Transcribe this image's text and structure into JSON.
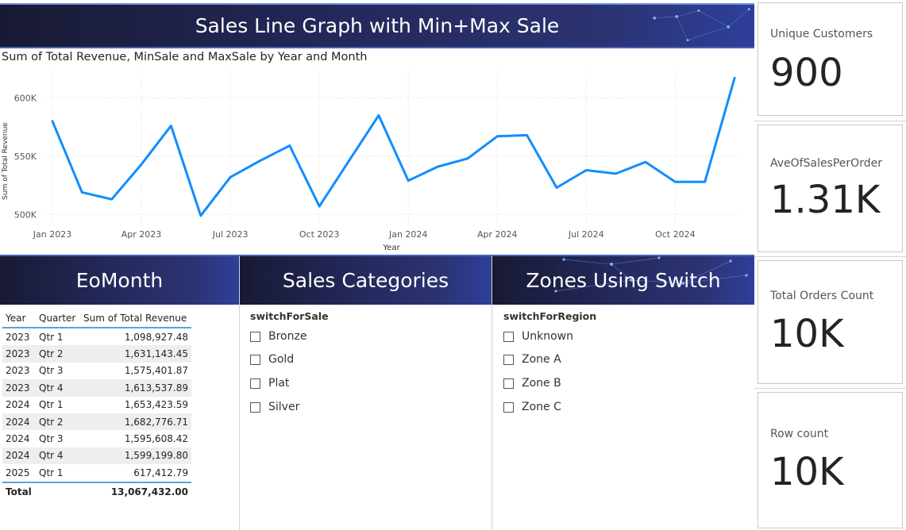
{
  "header": {
    "title": "Sales Line Graph with Min+Max Sale"
  },
  "chart_data": {
    "type": "line",
    "title": "Sum of Total Revenue, MinSale and MaxSale by Year and Month",
    "xlabel": "Year",
    "ylabel": "Sum of Total Revenue",
    "x": [
      "2023-01",
      "2023-02",
      "2023-03",
      "2023-04",
      "2023-05",
      "2023-06",
      "2023-07",
      "2023-08",
      "2023-09",
      "2023-10",
      "2023-11",
      "2023-12",
      "2024-01",
      "2024-02",
      "2024-03",
      "2024-04",
      "2024-05",
      "2024-06",
      "2024-07",
      "2024-08",
      "2024-09",
      "2024-10",
      "2024-11",
      "2024-12",
      "2025-01"
    ],
    "x_tick_labels": [
      "Jan 2023",
      "Apr 2023",
      "Jul 2023",
      "Oct 2023",
      "Jan 2024",
      "Apr 2024",
      "Jul 2024",
      "Oct 2024"
    ],
    "y_tick_labels": [
      "500K",
      "550K",
      "600K"
    ],
    "y_ticks": [
      500000,
      550000,
      600000
    ],
    "ylim": [
      490000,
      622000
    ],
    "grid": true,
    "series": [
      {
        "values": [
          580000,
          519000,
          513000,
          543000,
          576000,
          499000,
          532000,
          546000,
          559000,
          507000,
          546000,
          585000,
          529000,
          541000,
          548000,
          567000,
          568000,
          523000,
          538000,
          535000,
          545000,
          528000,
          528000,
          617000
        ]
      }
    ]
  },
  "series_color": "#118dff",
  "sections": {
    "eomonth": "EoMonth",
    "sales_categories": "Sales Categories",
    "zones": "Zones Using Switch"
  },
  "matrix": {
    "headers": [
      "Year",
      "Quarter",
      "Sum of Total Revenue"
    ],
    "rows": [
      [
        "2023",
        "Qtr 1",
        "1,098,927.48"
      ],
      [
        "2023",
        "Qtr 2",
        "1,631,143.45"
      ],
      [
        "2023",
        "Qtr 3",
        "1,575,401.87"
      ],
      [
        "2023",
        "Qtr 4",
        "1,613,537.89"
      ],
      [
        "2024",
        "Qtr 1",
        "1,653,423.59"
      ],
      [
        "2024",
        "Qtr 2",
        "1,682,776.71"
      ],
      [
        "2024",
        "Qtr 3",
        "1,595,608.42"
      ],
      [
        "2024",
        "Qtr 4",
        "1,599,199.80"
      ],
      [
        "2025",
        "Qtr 1",
        "617,412.79"
      ]
    ],
    "total_label": "Total",
    "total_value": "13,067,432.00"
  },
  "slicer_sale": {
    "title": "switchForSale",
    "options": [
      "Bronze",
      "Gold",
      "Plat",
      "Silver"
    ]
  },
  "slicer_region": {
    "title": "switchForRegion",
    "options": [
      "Unknown",
      "Zone A",
      "Zone B",
      "Zone C"
    ]
  },
  "cards": [
    {
      "label": "Unique Customers",
      "value": "900"
    },
    {
      "label": "AveOfSalesPerOrder",
      "value": "1.31K"
    },
    {
      "label": "Total Orders Count",
      "value": "10K"
    },
    {
      "label": "Row count",
      "value": "10K"
    }
  ]
}
